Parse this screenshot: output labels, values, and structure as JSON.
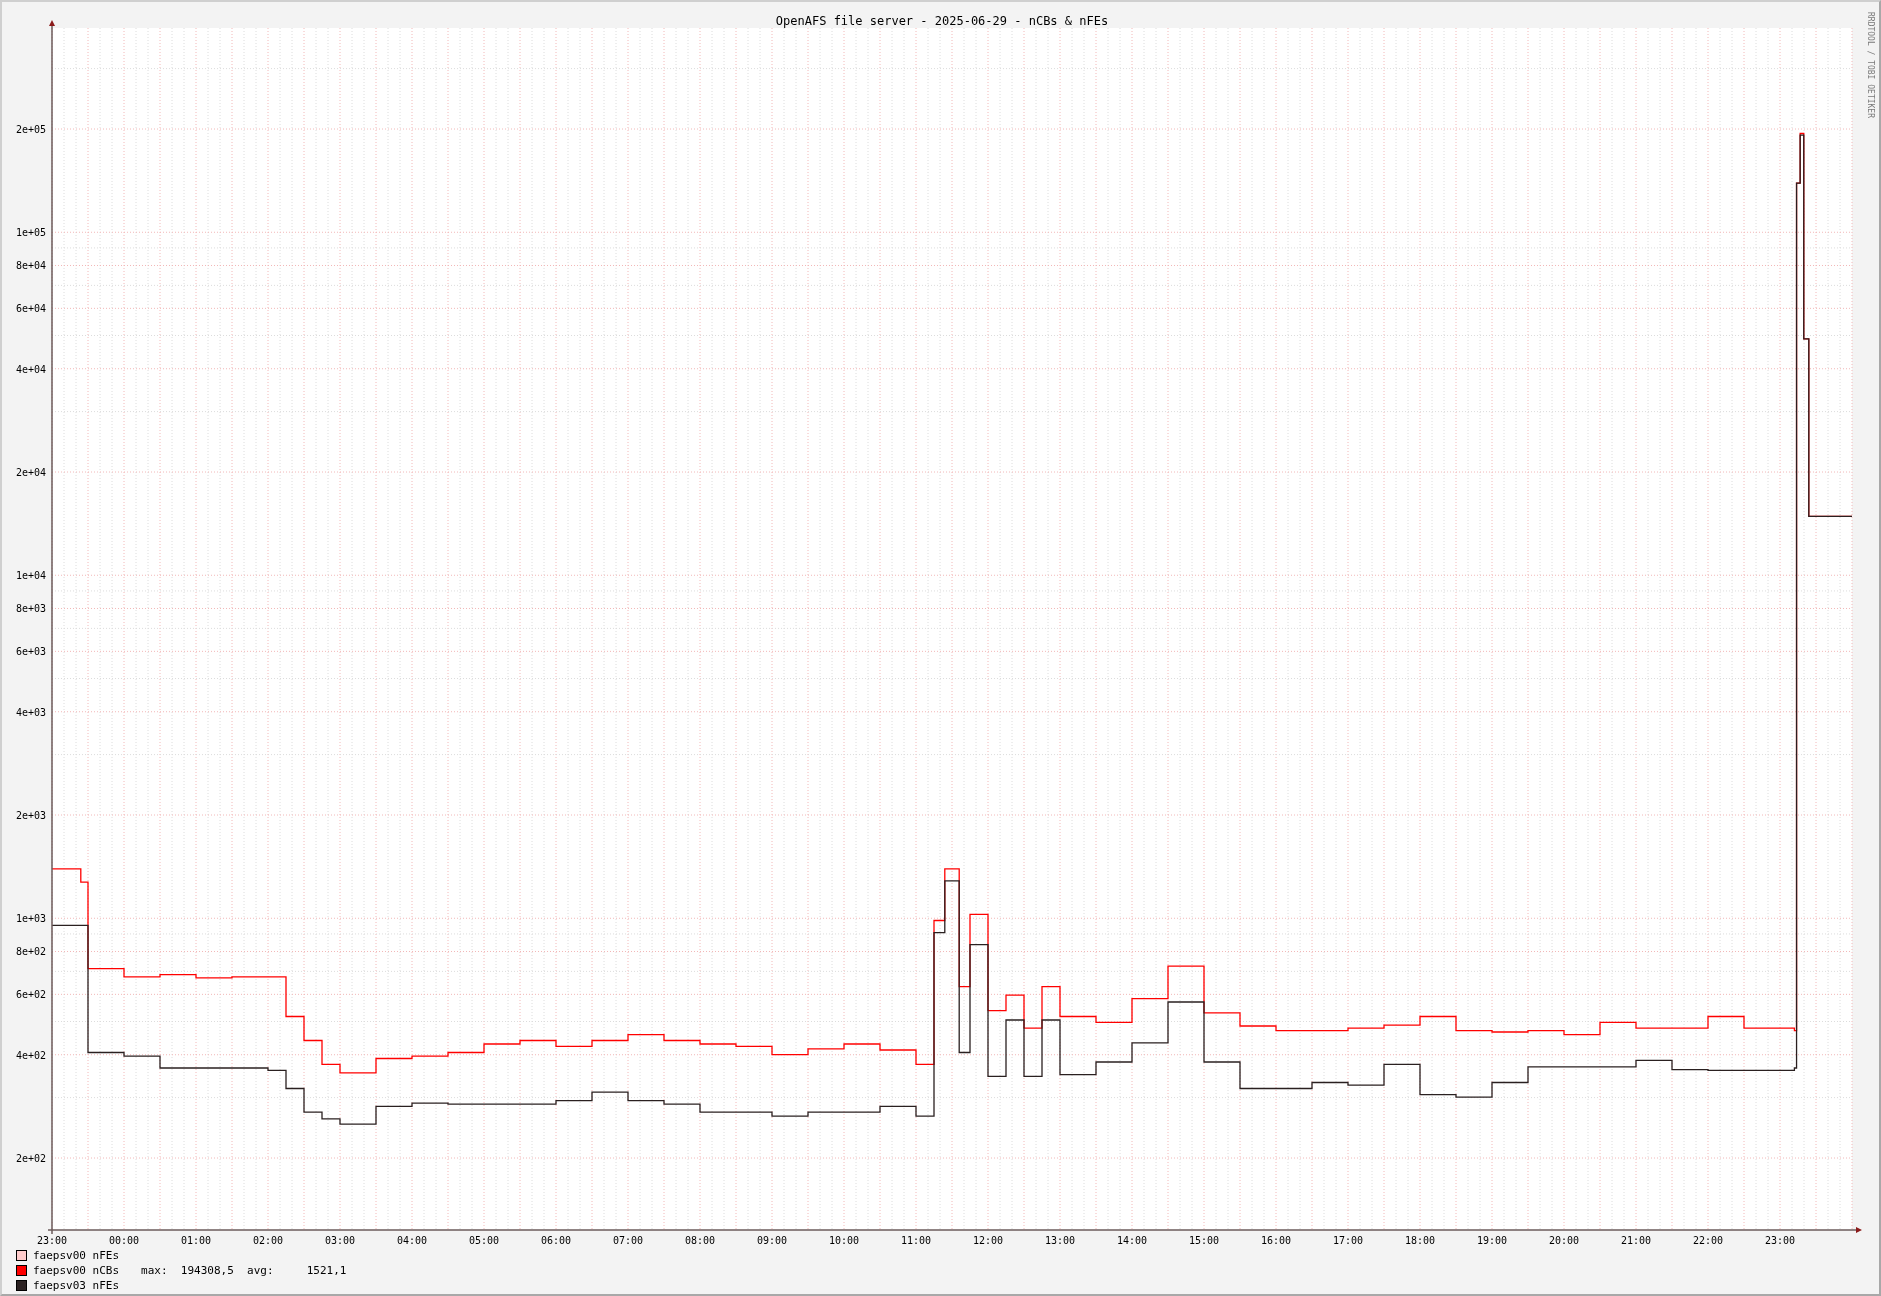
{
  "graph": {
    "title": "OpenAFS file server - 2025-06-29 - nCBs & nFEs",
    "x_axis_labels": [
      "23:00",
      "00:00",
      "01:00",
      "02:00",
      "03:00",
      "04:00",
      "05:00",
      "06:00",
      "07:00",
      "08:00",
      "09:00",
      "10:00",
      "11:00",
      "12:00",
      "13:00",
      "14:00",
      "15:00",
      "16:00",
      "17:00",
      "18:00",
      "19:00",
      "20:00",
      "21:00",
      "22:00",
      "23:00"
    ],
    "y_axis_labels": [
      "2e+05",
      "1e+05",
      "8e+04",
      "6e+04",
      "4e+04",
      "2e+04",
      "1e+04",
      "8e+03",
      "6e+03",
      "4e+03",
      "2e+03",
      "1e+03",
      "8e+02",
      "6e+02",
      "4e+02",
      "2e+02"
    ],
    "credit": "RRDTOOL / TOBI OETIKER"
  },
  "legend": [
    {
      "label": "faepsv00 nFEs",
      "color": "#ffcccc"
    },
    {
      "label": "faepsv00 nCBs",
      "color": "#ff0000",
      "stats": "max:  194308,5  avg:     1521,1"
    },
    {
      "label": "faepsv03 nFEs",
      "color": "#2a2020"
    }
  ]
}
